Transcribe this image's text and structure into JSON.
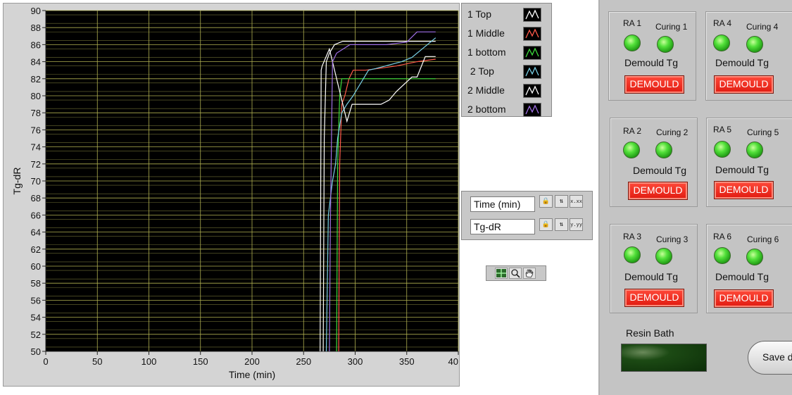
{
  "chart_data": {
    "type": "line",
    "xlabel": "Time (min)",
    "ylabel": "Tg-dR",
    "xlim": [
      0,
      400
    ],
    "ylim": [
      50,
      90
    ],
    "x_ticks": [
      0,
      50,
      100,
      150,
      200,
      250,
      300,
      350,
      400
    ],
    "x_tick_labels": [
      "0",
      "50",
      "100",
      "150",
      "200",
      "250",
      "300",
      "350",
      "40"
    ],
    "y_ticks": [
      50,
      52,
      54,
      56,
      58,
      60,
      62,
      64,
      66,
      68,
      70,
      72,
      74,
      76,
      78,
      80,
      82,
      84,
      86,
      88,
      90
    ],
    "grid": true,
    "background": "#000000",
    "grid_color_major": "#b0b050",
    "grid_color_minor": "#6e6e34",
    "series": [
      {
        "name": "1 Top",
        "color": "#ffffff",
        "x": [
          269,
          270,
          272,
          275,
          280,
          288,
          300,
          340,
          370,
          378
        ],
        "y": [
          50,
          75,
          84,
          85,
          86,
          86.4,
          86.4,
          86.4,
          86.4,
          86.4
        ]
      },
      {
        "name": "1 Middle",
        "color": "#ff5a4a",
        "x": [
          284,
          285,
          287,
          290,
          294,
          298,
          310,
          340,
          360,
          378
        ],
        "y": [
          50,
          72,
          79,
          80,
          82,
          83,
          83,
          83.5,
          84,
          84.3
        ]
      },
      {
        "name": "1 bottom",
        "color": "#3cdc3c",
        "x": [
          282,
          283,
          285,
          287,
          300,
          340,
          378
        ],
        "y": [
          50,
          72,
          80,
          82,
          82,
          82,
          82
        ]
      },
      {
        "name": "2 Top",
        "color": "#78d0e6",
        "x": [
          272,
          274,
          278,
          281,
          283,
          287,
          292,
          298,
          313,
          320,
          345,
          355,
          378
        ],
        "y": [
          50,
          66,
          70,
          72,
          75,
          78,
          79,
          80,
          83,
          83.2,
          84,
          84.5,
          86.8
        ]
      },
      {
        "name": "2 Middle",
        "color": "#ffffff",
        "x": [
          266,
          267,
          268,
          275,
          292,
          297,
          325,
          333,
          340,
          355,
          360,
          368,
          378
        ],
        "y": [
          50,
          83,
          83.5,
          85.5,
          77,
          79,
          79,
          79.5,
          80.5,
          82.2,
          82.2,
          84.6,
          84.6
        ]
      },
      {
        "name": "2 bottom",
        "color": "#a070e6",
        "x": [
          275,
          276,
          278,
          282,
          295,
          330,
          350,
          360,
          378
        ],
        "y": [
          50,
          65,
          84,
          85,
          86,
          86,
          86.3,
          87.5,
          87.5
        ]
      }
    ]
  },
  "legend": {
    "items": [
      "1 Top",
      "1 Middle",
      "1 bottom",
      " 2 Top",
      "2 Middle",
      "2 bottom"
    ]
  },
  "scale_legend": {
    "x_name": "Time (min)",
    "y_name": "Tg-dR",
    "x_format": "x.xx",
    "y_format": "y.yy"
  },
  "stations": [
    {
      "ra": "RA 1",
      "curing": "Curing 1",
      "tg": "Demould Tg",
      "button": "DEMOULD"
    },
    {
      "ra": "RA 4",
      "curing": "Curing 4",
      "tg": "Demould Tg",
      "button": "DEMOULD"
    },
    {
      "ra": "RA 2",
      "curing": "Curing 2",
      "tg": "Demould Tg",
      "button": "DEMOULD"
    },
    {
      "ra": "RA 5",
      "curing": "Curing 5",
      "tg": "Demould Tg",
      "button": "DEMOULD"
    },
    {
      "ra": "RA 3",
      "curing": "Curing 3",
      "tg": "Demould Tg",
      "button": "DEMOULD"
    },
    {
      "ra": "RA 6",
      "curing": "Curing 6",
      "tg": "Demould Tg",
      "button": "DEMOULD"
    }
  ],
  "resin": {
    "label": "Resin Bath"
  },
  "save": {
    "label": "Save d"
  },
  "colors": {
    "led_on": "#52e03a",
    "demould_red": "#e8241a",
    "panel_gray": "#c4c4c4"
  }
}
